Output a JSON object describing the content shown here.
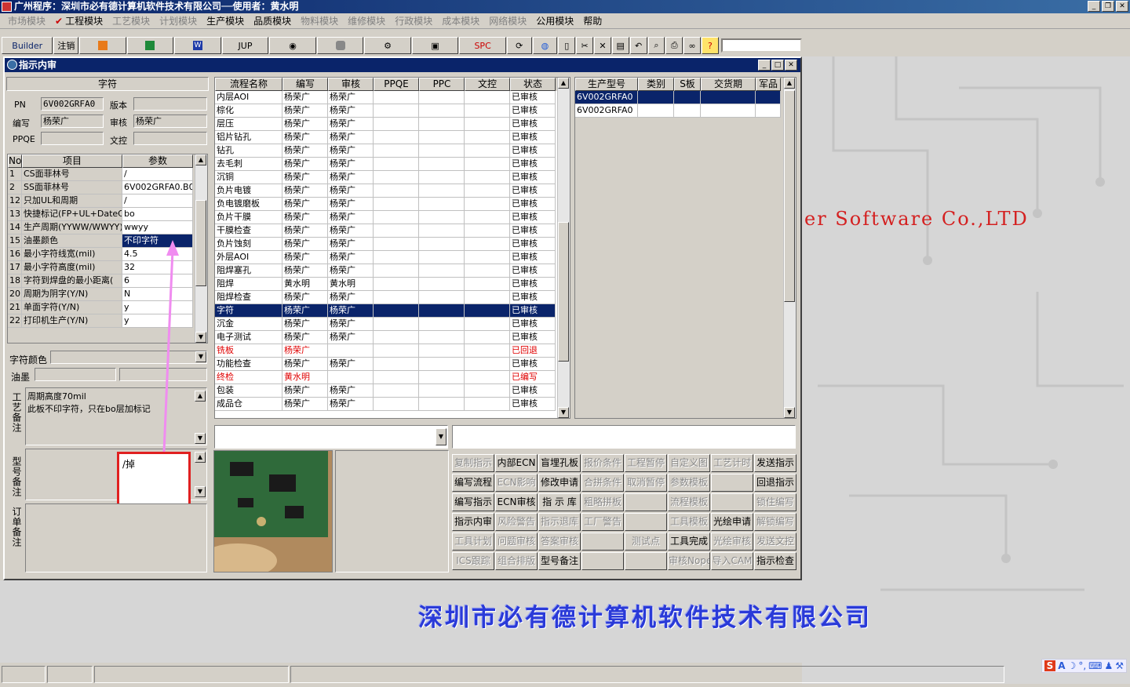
{
  "app": {
    "title": "广州程序：深圳市必有德计算机软件技术有限公司──使用者：黄水明"
  },
  "menu": [
    {
      "label": "市场模块",
      "enabled": false
    },
    {
      "label": "工程模块",
      "enabled": true,
      "checked": true
    },
    {
      "label": "工艺模块",
      "enabled": false
    },
    {
      "label": "计划模块",
      "enabled": false
    },
    {
      "label": "生产模块",
      "enabled": true
    },
    {
      "label": "品质模块",
      "enabled": true
    },
    {
      "label": "物料模块",
      "enabled": false
    },
    {
      "label": "维修模块",
      "enabled": false
    },
    {
      "label": "行政模块",
      "enabled": false
    },
    {
      "label": "成本模块",
      "enabled": false
    },
    {
      "label": "网络模块",
      "enabled": false
    },
    {
      "label": "公用模块",
      "enabled": true
    },
    {
      "label": "帮助",
      "enabled": true
    }
  ],
  "toolbar": {
    "builder": "Builder",
    "logout": "注销",
    "jup": "JUP",
    "spc": "SPC"
  },
  "child": {
    "title": "指示内审"
  },
  "left": {
    "header": "字符",
    "pn_label": "PN",
    "pn_value": "6V002GRFA0",
    "version_label": "版本",
    "version_value": "",
    "author_label": "编写",
    "author_value": "杨荣广",
    "review_label": "审核",
    "review_value": "杨荣广",
    "ppqe_label": "PPQE",
    "ppqe_value": "",
    "doc_label": "文控",
    "doc_value": "",
    "param_headers": [
      "No",
      "项目",
      "参数"
    ],
    "params": [
      {
        "no": "1",
        "item": "CS面菲林号",
        "value": "/"
      },
      {
        "no": "2",
        "item": "SS面菲林号",
        "value": "6V002GRFA0.B0"
      },
      {
        "no": "12",
        "item": "只加UL和周期",
        "value": "/"
      },
      {
        "no": "13",
        "item": "快捷标记(FP+UL+DateCo",
        "value": "bo"
      },
      {
        "no": "14",
        "item": "生产周期(YYWW/WWYY)",
        "value": "wwyy"
      },
      {
        "no": "15",
        "item": "油墨颜色",
        "value": "不印字符"
      },
      {
        "no": "16",
        "item": "最小字符线宽(mil)",
        "value": "4.5"
      },
      {
        "no": "17",
        "item": "最小字符高度(mil)",
        "value": "32"
      },
      {
        "no": "18",
        "item": "字符到焊盘的最小距离(",
        "value": "6"
      },
      {
        "no": "20",
        "item": "周期为阴字(Y/N)",
        "value": "N"
      },
      {
        "no": "21",
        "item": "单面字符(Y/N)",
        "value": "y"
      },
      {
        "no": "22",
        "item": "打印机生产(Y/N)",
        "value": "y"
      }
    ],
    "char_color_label": "字符颜色",
    "ink_label": "油墨",
    "process_note_label": "工艺备注",
    "process_note": "周期高度70mil\n此板不印字符，只在bo层加标记",
    "model_note_label": "型号备注",
    "model_note": "/掉",
    "order_note_label": "订单备注"
  },
  "process": {
    "headers": [
      "流程名称",
      "编写",
      "审核",
      "PPQE",
      "PPC",
      "文控",
      "状态"
    ],
    "rows": [
      [
        "内层AOI",
        "杨荣广",
        "杨荣广",
        "",
        "",
        "",
        "已审核"
      ],
      [
        "棕化",
        "杨荣广",
        "杨荣广",
        "",
        "",
        "",
        "已审核"
      ],
      [
        "层压",
        "杨荣广",
        "杨荣广",
        "",
        "",
        "",
        "已审核"
      ],
      [
        "铝片钻孔",
        "杨荣广",
        "杨荣广",
        "",
        "",
        "",
        "已审核"
      ],
      [
        "钻孔",
        "杨荣广",
        "杨荣广",
        "",
        "",
        "",
        "已审核"
      ],
      [
        "去毛刺",
        "杨荣广",
        "杨荣广",
        "",
        "",
        "",
        "已审核"
      ],
      [
        "沉铜",
        "杨荣广",
        "杨荣广",
        "",
        "",
        "",
        "已审核"
      ],
      [
        "负片电镀",
        "杨荣广",
        "杨荣广",
        "",
        "",
        "",
        "已审核"
      ],
      [
        "负电镀磨板",
        "杨荣广",
        "杨荣广",
        "",
        "",
        "",
        "已审核"
      ],
      [
        "负片干膜",
        "杨荣广",
        "杨荣广",
        "",
        "",
        "",
        "已审核"
      ],
      [
        "干膜检查",
        "杨荣广",
        "杨荣广",
        "",
        "",
        "",
        "已审核"
      ],
      [
        "负片蚀刻",
        "杨荣广",
        "杨荣广",
        "",
        "",
        "",
        "已审核"
      ],
      [
        "外层AOI",
        "杨荣广",
        "杨荣广",
        "",
        "",
        "",
        "已审核"
      ],
      [
        "阻焊塞孔",
        "杨荣广",
        "杨荣广",
        "",
        "",
        "",
        "已审核"
      ],
      [
        "阻焊",
        "黄水明",
        "黄水明",
        "",
        "",
        "",
        "已审核"
      ],
      [
        "阻焊检查",
        "杨荣广",
        "杨荣广",
        "",
        "",
        "",
        "已审核"
      ],
      [
        "字符",
        "杨荣广",
        "杨荣广",
        "",
        "",
        "",
        "已审核"
      ],
      [
        "沉金",
        "杨荣广",
        "杨荣广",
        "",
        "",
        "",
        "已审核"
      ],
      [
        "电子测试",
        "杨荣广",
        "杨荣广",
        "",
        "",
        "",
        "已审核"
      ],
      [
        "铣板",
        "杨荣广",
        "",
        "",
        "",
        "",
        "已回退"
      ],
      [
        "功能检查",
        "杨荣广",
        "杨荣广",
        "",
        "",
        "",
        "已审核"
      ],
      [
        "终检",
        "黄水明",
        "",
        "",
        "",
        "",
        "已编写"
      ],
      [
        "包装",
        "杨荣广",
        "杨荣广",
        "",
        "",
        "",
        "已审核"
      ],
      [
        "成品仓",
        "杨荣广",
        "杨荣广",
        "",
        "",
        "",
        "已审核"
      ]
    ],
    "selected_index": 16,
    "red_indices": [
      19,
      21
    ]
  },
  "models": {
    "headers": [
      "生产型号",
      "类别",
      "S板",
      "交货期",
      "军品"
    ],
    "rows": [
      [
        "6V002GRFA0",
        "",
        "",
        "",
        ""
      ],
      [
        "6V002GRFA0",
        "",
        "",
        "",
        ""
      ]
    ]
  },
  "actions": [
    [
      {
        "l": "复制指示",
        "e": false
      },
      {
        "l": "内部ECN",
        "e": true
      },
      {
        "l": "盲埋孔板",
        "e": true
      },
      {
        "l": "报价条件",
        "e": false
      },
      {
        "l": "工程暂停",
        "e": false
      },
      {
        "l": "自定义图",
        "e": false
      },
      {
        "l": "工艺计时",
        "e": false
      },
      {
        "l": "发送指示",
        "e": true
      }
    ],
    [
      {
        "l": "编写流程",
        "e": true
      },
      {
        "l": "ECN影响",
        "e": false
      },
      {
        "l": "修改申请",
        "e": true
      },
      {
        "l": "合拼条件",
        "e": false
      },
      {
        "l": "取消暂停",
        "e": false
      },
      {
        "l": "参数模板",
        "e": false
      },
      {
        "l": "",
        "e": false
      },
      {
        "l": "回退指示",
        "e": true
      }
    ],
    [
      {
        "l": "编写指示",
        "e": true
      },
      {
        "l": "ECN审核",
        "e": true
      },
      {
        "l": "指 示 库",
        "e": true
      },
      {
        "l": "粗略拼板",
        "e": false
      },
      {
        "l": "",
        "e": false
      },
      {
        "l": "流程模板",
        "e": false
      },
      {
        "l": "",
        "e": false
      },
      {
        "l": "锁住编写",
        "e": false
      }
    ],
    [
      {
        "l": "指示内审",
        "e": true
      },
      {
        "l": "风险警告",
        "e": false
      },
      {
        "l": "指示退库",
        "e": false
      },
      {
        "l": "工厂警告",
        "e": false
      },
      {
        "l": "",
        "e": false
      },
      {
        "l": "工具模板",
        "e": false
      },
      {
        "l": "光绘申请",
        "e": true
      },
      {
        "l": "解锁编写",
        "e": false
      }
    ],
    [
      {
        "l": "工具计划",
        "e": false
      },
      {
        "l": "问题审核",
        "e": false
      },
      {
        "l": "答案审核",
        "e": false
      },
      {
        "l": "",
        "e": false
      },
      {
        "l": "测试点",
        "e": false
      },
      {
        "l": "工具完成",
        "e": true
      },
      {
        "l": "光绘审核",
        "e": false
      },
      {
        "l": "发送文控",
        "e": false
      }
    ],
    [
      {
        "l": "ICS跟踪",
        "e": false
      },
      {
        "l": "组合排版",
        "e": false
      },
      {
        "l": "型号备注",
        "e": true
      },
      {
        "l": "",
        "e": false
      },
      {
        "l": "",
        "e": false
      },
      {
        "l": "审核Nope",
        "e": false
      },
      {
        "l": "导入CAM",
        "e": false
      },
      {
        "l": "指示检查",
        "e": true
      }
    ]
  ],
  "background": {
    "brand_en": "er Software Co.,LTD",
    "brand_cn": "深圳市必有德计算机软件技术有限公司"
  },
  "tray": {
    "ime": "S",
    "a": "A"
  },
  "colors": {
    "title": "#0a246a",
    "selected": "#0a246a",
    "red": "#e00000",
    "annotation": "#f08cf0",
    "box": "#e02020"
  }
}
